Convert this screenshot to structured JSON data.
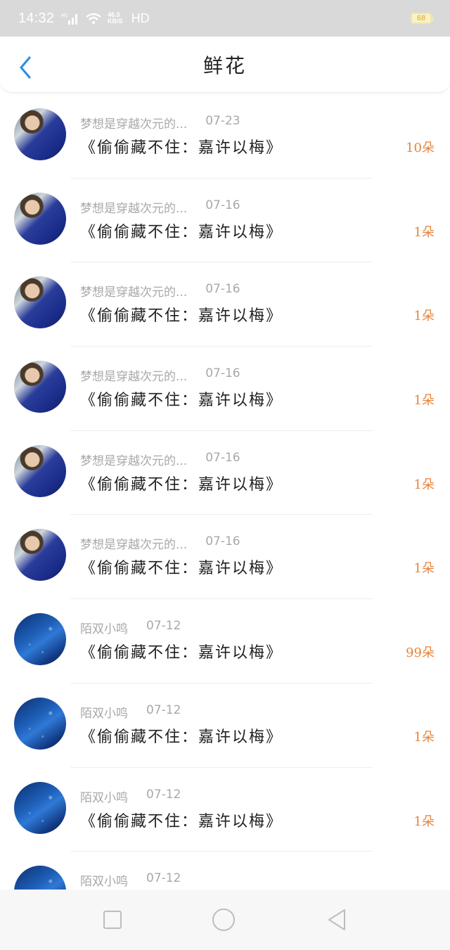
{
  "status_bar": {
    "time": "14:32",
    "network": "4G",
    "speed": "46.0",
    "speed_unit": "KB/S",
    "hd": "HD",
    "battery": "68"
  },
  "header": {
    "title": "鲜花"
  },
  "list": [
    {
      "user": "梦想是穿越次元的...",
      "date": "07-23",
      "book": "《偷偷藏不住：嘉许以梅》",
      "count": "10朵",
      "avatar": "person"
    },
    {
      "user": "梦想是穿越次元的...",
      "date": "07-16",
      "book": "《偷偷藏不住：嘉许以梅》",
      "count": "1朵",
      "avatar": "person"
    },
    {
      "user": "梦想是穿越次元的...",
      "date": "07-16",
      "book": "《偷偷藏不住：嘉许以梅》",
      "count": "1朵",
      "avatar": "person"
    },
    {
      "user": "梦想是穿越次元的...",
      "date": "07-16",
      "book": "《偷偷藏不住：嘉许以梅》",
      "count": "1朵",
      "avatar": "person"
    },
    {
      "user": "梦想是穿越次元的...",
      "date": "07-16",
      "book": "《偷偷藏不住：嘉许以梅》",
      "count": "1朵",
      "avatar": "person"
    },
    {
      "user": "梦想是穿越次元的...",
      "date": "07-16",
      "book": "《偷偷藏不住：嘉许以梅》",
      "count": "1朵",
      "avatar": "person"
    },
    {
      "user": "陌双小鸣",
      "date": "07-12",
      "book": "《偷偷藏不住：嘉许以梅》",
      "count": "99朵",
      "avatar": "galaxy"
    },
    {
      "user": "陌双小鸣",
      "date": "07-12",
      "book": "《偷偷藏不住：嘉许以梅》",
      "count": "1朵",
      "avatar": "galaxy"
    },
    {
      "user": "陌双小鸣",
      "date": "07-12",
      "book": "《偷偷藏不住：嘉许以梅》",
      "count": "1朵",
      "avatar": "galaxy"
    },
    {
      "user": "陌双小鸣",
      "date": "07-12",
      "book": "",
      "count": "",
      "avatar": "galaxy"
    }
  ],
  "icons": {
    "back": "chevron-left-icon",
    "recent": "square-icon",
    "home": "circle-icon",
    "back_nav": "triangle-left-icon"
  },
  "colors": {
    "accent": "#2f8ee5",
    "count": "#e8833a"
  }
}
